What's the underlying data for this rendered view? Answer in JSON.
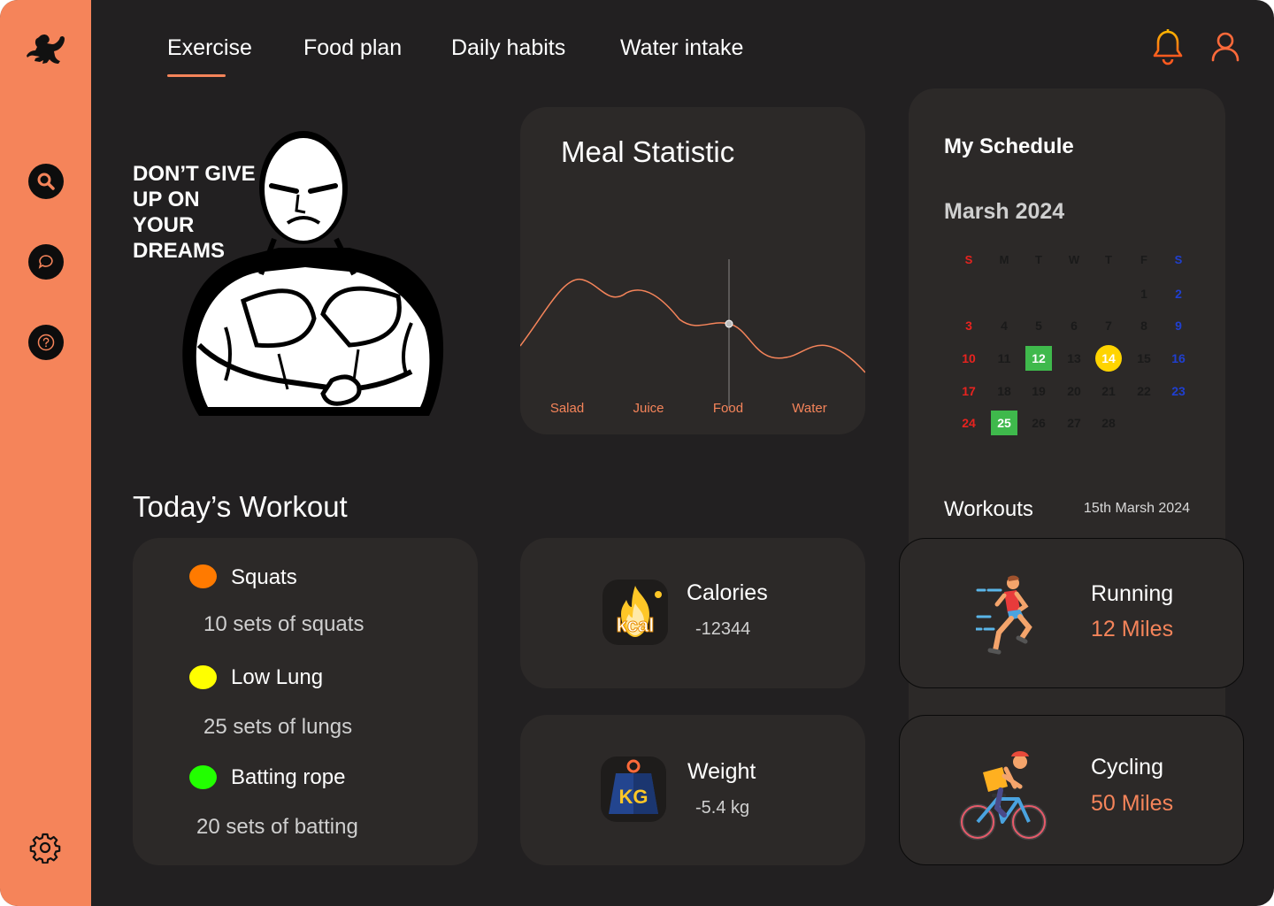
{
  "nav": {
    "tabs": [
      {
        "label": "Exercise",
        "active": true
      },
      {
        "label": "Food plan",
        "active": false
      },
      {
        "label": "Daily habits",
        "active": false
      },
      {
        "label": "Water intake",
        "active": false
      }
    ]
  },
  "sidebar": {
    "icons": [
      "flexing-bodybuilder-icon",
      "search-icon",
      "chat-icon",
      "help-icon",
      "gear-icon"
    ]
  },
  "header_icons": [
    "bell-icon",
    "user-icon"
  ],
  "hero": {
    "slogan": "DON’T GIVE UP ON YOUR DREAMS"
  },
  "meal": {
    "title": "Meal Statistic",
    "categories": [
      "Salad",
      "Juice",
      "Food",
      "Water"
    ]
  },
  "schedule": {
    "title": "My Schedule",
    "month": "Marsh",
    "year": "2024",
    "weekdays": [
      "S",
      "M",
      "T",
      "W",
      "T",
      "F",
      "S"
    ],
    "weeks": [
      [
        "",
        "",
        "",
        "",
        "",
        "1",
        "2"
      ],
      [
        "3",
        "4",
        "5",
        "6",
        "7",
        "8",
        "9"
      ],
      [
        "10",
        "11",
        "12",
        "13",
        "14",
        "15",
        "16"
      ],
      [
        "17",
        "18",
        "19",
        "20",
        "21",
        "22",
        "23"
      ],
      [
        "24",
        "25",
        "26",
        "27",
        "28",
        "",
        ""
      ]
    ],
    "highlighted": {
      "12": "green",
      "14": "yellow",
      "25": "green"
    },
    "workouts_label": "Workouts",
    "workouts_date": "15th Marsh 2024"
  },
  "todays_workout": {
    "title": "Today’s Workout",
    "items": [
      {
        "name": "Squats",
        "detail": "10 sets of squats",
        "color": "#ff7a00"
      },
      {
        "name": "Low Lung",
        "detail": "25 sets of lungs",
        "color": "#ffff00"
      },
      {
        "name": "Batting rope",
        "detail": "20 sets of batting",
        "color": "#22ff00"
      }
    ]
  },
  "stats": {
    "calories": {
      "label": "Calories",
      "value": "-12344",
      "icon": "kcal-flame-icon"
    },
    "weight": {
      "label": "Weight",
      "value": "-5.4 kg",
      "icon": "kg-weight-icon"
    }
  },
  "activities": [
    {
      "name": "Running",
      "value": "12 Miles",
      "icon": "runner-icon"
    },
    {
      "name": "Cycling",
      "value": "50 Miles",
      "icon": "cyclist-icon"
    }
  ],
  "colors": {
    "accent": "#f5845a",
    "background": "#222021",
    "card": "#2c2928"
  }
}
